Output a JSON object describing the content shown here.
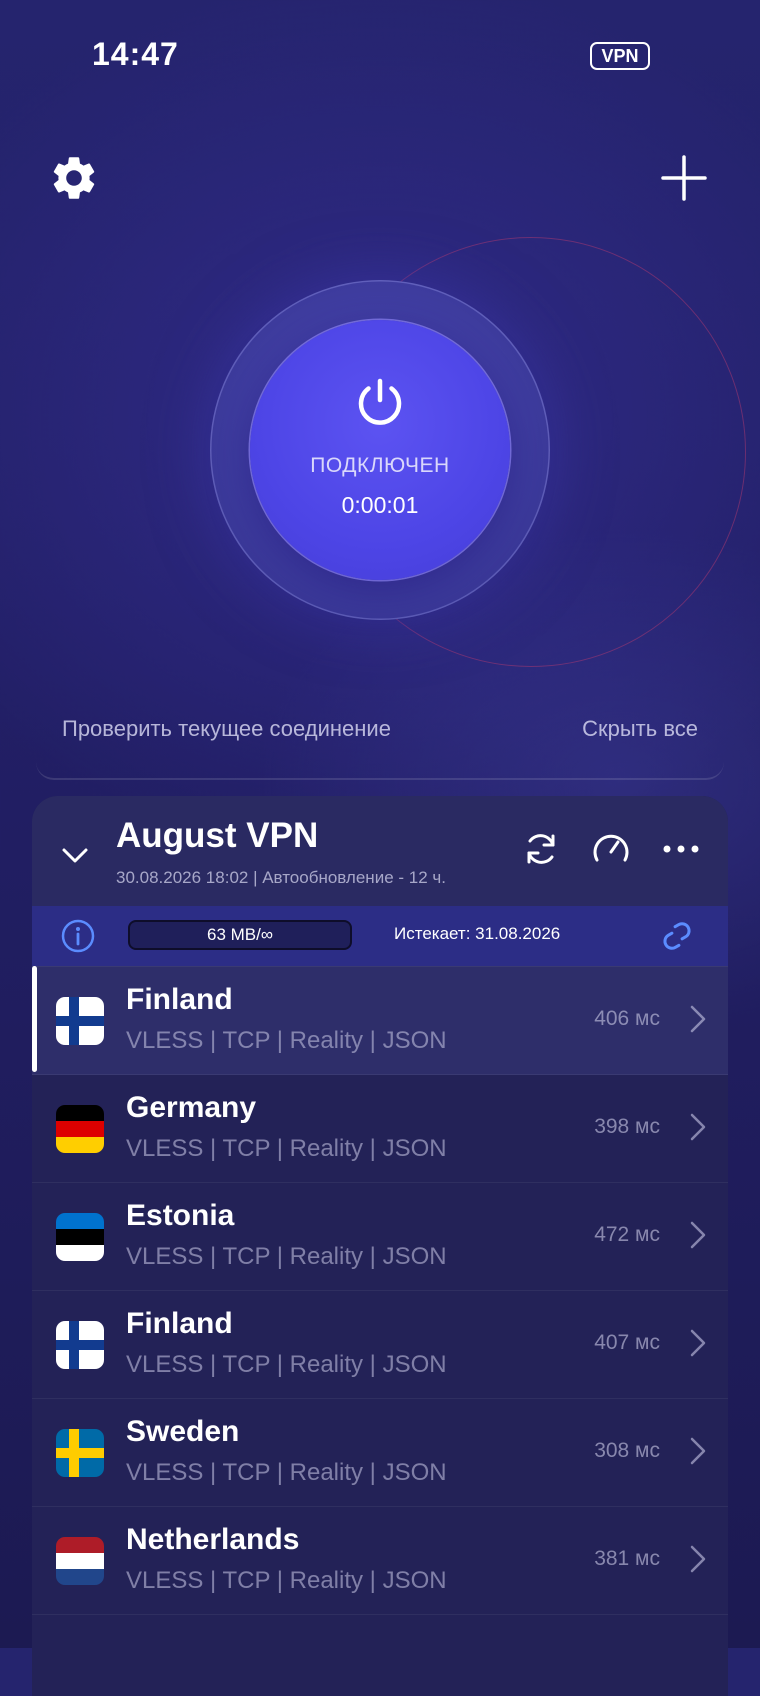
{
  "status_bar": {
    "time": "14:47",
    "vpn_badge": "VPN"
  },
  "connection": {
    "status": "ПОДКЛЮЧЕН",
    "timer": "0:00:01",
    "check_link": "Проверить текущее соединение",
    "hide_all_link": "Скрыть все"
  },
  "group": {
    "title": "August VPN",
    "subtitle": "30.08.2026 18:02 | Автообновление - 12 ч.",
    "traffic": "63 MB/∞",
    "expires": "Истекает: 31.08.2026"
  },
  "servers": [
    {
      "name": "Finland",
      "protocol": "VLESS | TCP | Reality | JSON",
      "ping": "406 мс",
      "flag": "finland",
      "active": true
    },
    {
      "name": "Germany",
      "protocol": "VLESS | TCP | Reality | JSON",
      "ping": "398 мс",
      "flag": "germany"
    },
    {
      "name": "Estonia",
      "protocol": "VLESS | TCP | Reality | JSON",
      "ping": "472 мс",
      "flag": "estonia"
    },
    {
      "name": "Finland",
      "protocol": "VLESS | TCP | Reality | JSON",
      "ping": "407 мс",
      "flag": "finland"
    },
    {
      "name": "Sweden",
      "protocol": "VLESS | TCP | Reality | JSON",
      "ping": "308 мс",
      "flag": "sweden"
    },
    {
      "name": "Netherlands",
      "protocol": "VLESS | TCP | Reality | JSON",
      "ping": "381 мс",
      "flag": "netherlands"
    }
  ],
  "colors": {
    "accent": "#4d45e6",
    "link_icon": "#5b8cff"
  }
}
